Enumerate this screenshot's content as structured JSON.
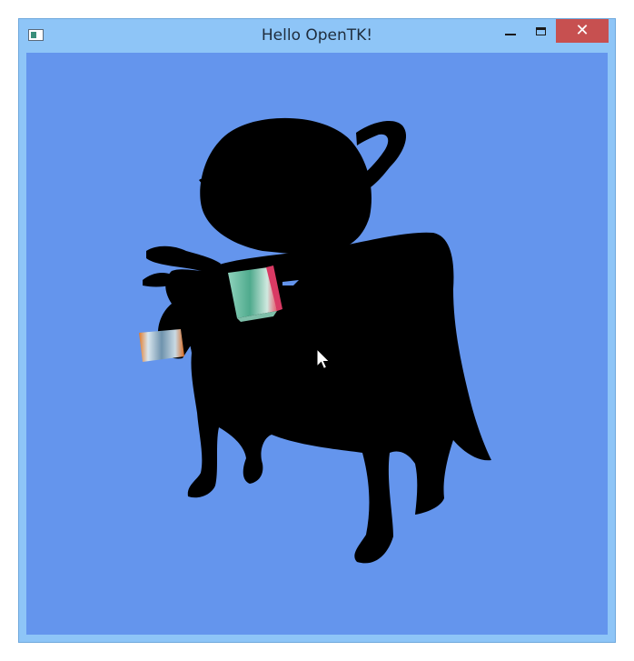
{
  "window": {
    "title": "Hello OpenTK!",
    "close_glyph": "✕"
  },
  "icons": {
    "app": "opentk-window-icon",
    "minimize": "minimize-icon",
    "maximize": "maximize-icon",
    "close": "close-icon",
    "cursor": "mouse-pointer-icon"
  },
  "colors": {
    "titlebar": "#8ec5f7",
    "clear_color": "#6495ed",
    "silhouette": "#000000",
    "close_button": "#c75050"
  },
  "scene": {
    "objects": [
      "teapot",
      "cow",
      "textured-cube-large",
      "textured-cube-small"
    ]
  }
}
